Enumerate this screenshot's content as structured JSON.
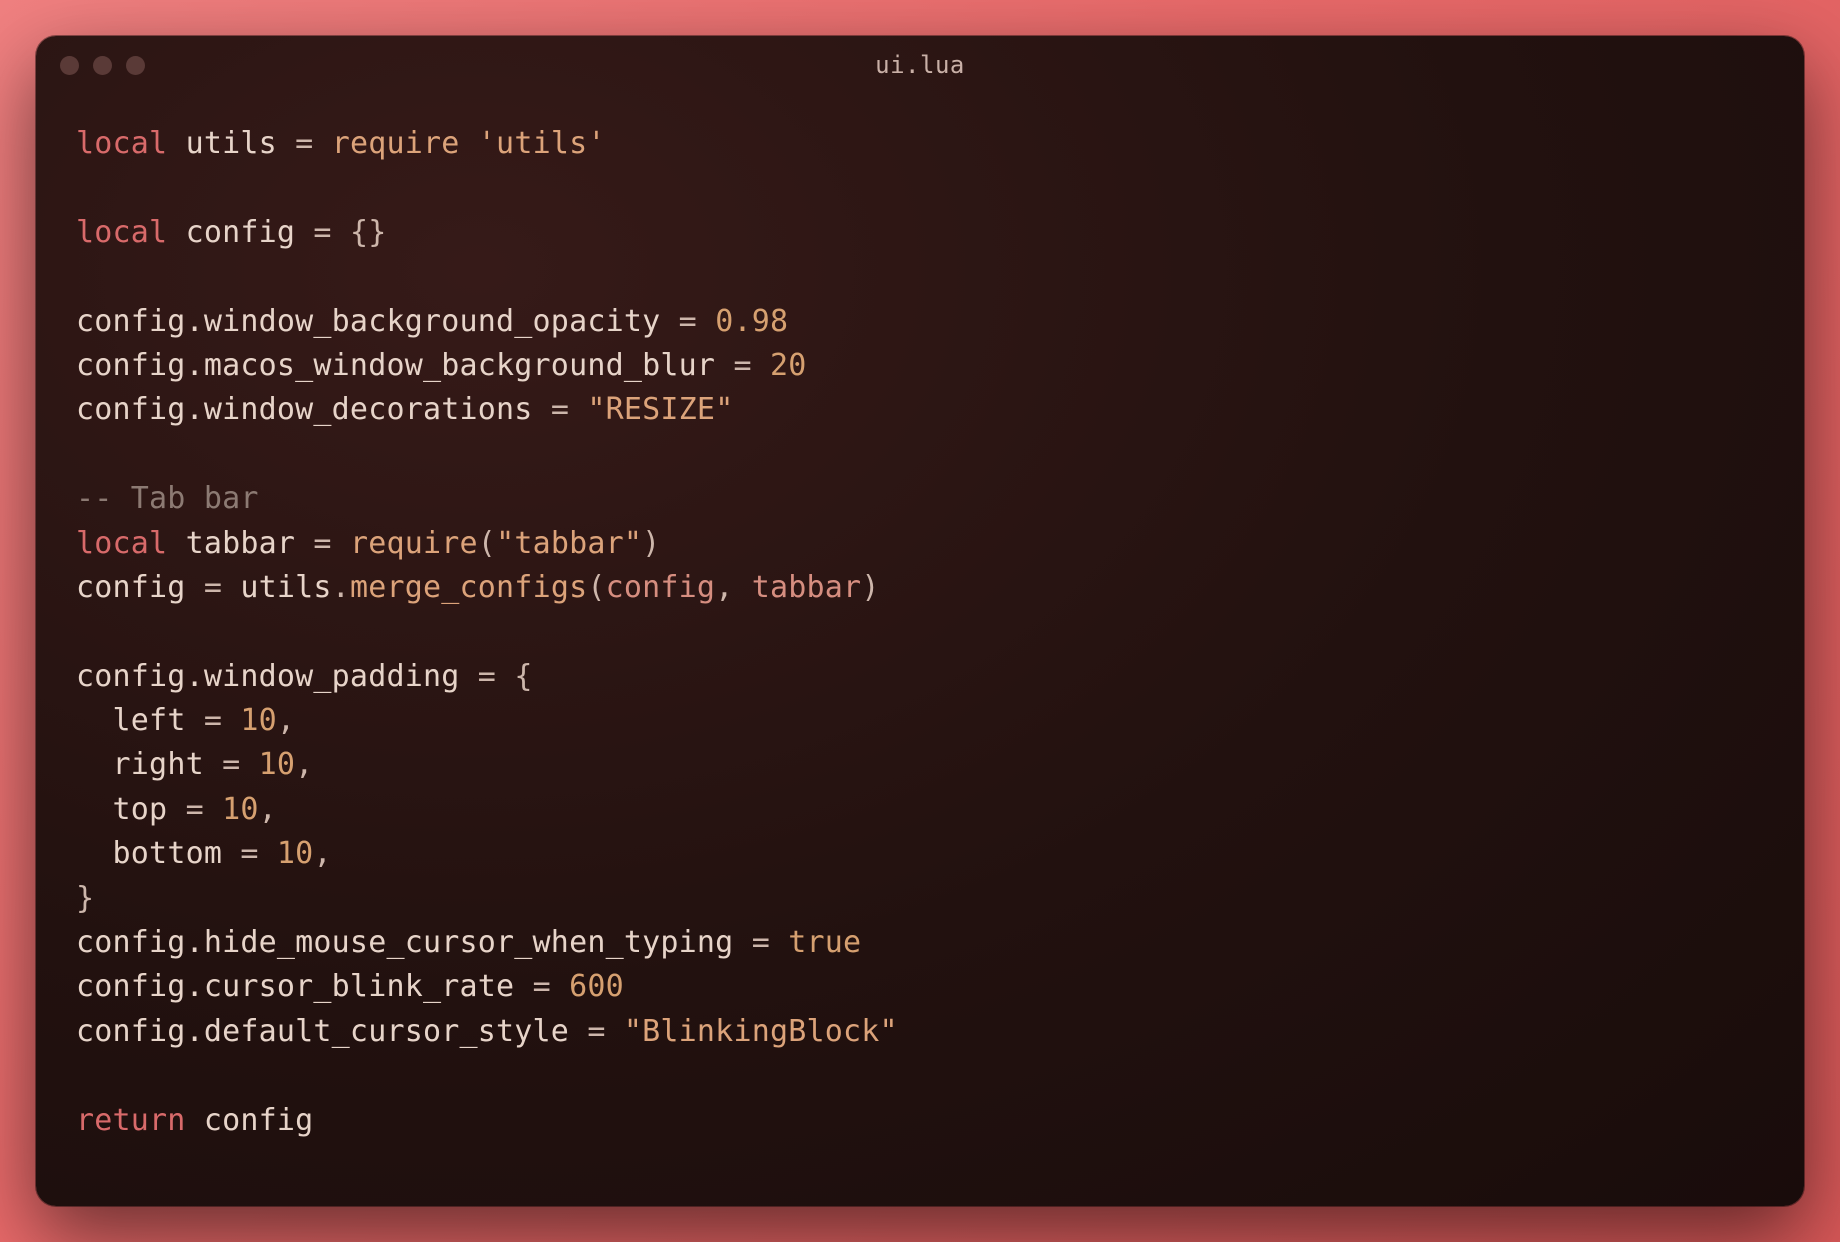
{
  "window": {
    "title": "ui.lua"
  },
  "code": {
    "l1": {
      "kw": "local",
      "id": "utils",
      "op": "=",
      "fn": "require",
      "str": "'utils'"
    },
    "l3": {
      "kw": "local",
      "id": "config",
      "op": "=",
      "p": "{}"
    },
    "l5": {
      "id": "config",
      "prop": ".window_background_opacity",
      "op": "=",
      "num": "0.98"
    },
    "l6": {
      "id": "config",
      "prop": ".macos_window_background_blur",
      "op": "=",
      "num": "20"
    },
    "l7": {
      "id": "config",
      "prop": ".window_decorations",
      "op": "=",
      "str": "\"RESIZE\""
    },
    "l9": {
      "cmt": "-- Tab bar"
    },
    "l10": {
      "kw": "local",
      "id": "tabbar",
      "op": "=",
      "fn": "require",
      "po": "(",
      "str": "\"tabbar\"",
      "pc": ")"
    },
    "l11": {
      "id": "config",
      "op": "=",
      "obj": "utils",
      "dot": ".",
      "fn": "merge_configs",
      "po": "(",
      "a1": "config",
      "comma": ",",
      "a2": "tabbar",
      "pc": ")"
    },
    "l13": {
      "id": "config",
      "prop": ".window_padding",
      "op": "=",
      "p": "{"
    },
    "l14": {
      "pad": "  ",
      "k": "left",
      "op": "=",
      "num": "10",
      "c": ","
    },
    "l15": {
      "pad": "  ",
      "k": "right",
      "op": "=",
      "num": "10",
      "c": ","
    },
    "l16": {
      "pad": "  ",
      "k": "top",
      "op": "=",
      "num": "10",
      "c": ","
    },
    "l17": {
      "pad": "  ",
      "k": "bottom",
      "op": "=",
      "num": "10",
      "c": ","
    },
    "l18": {
      "p": "}"
    },
    "l19": {
      "id": "config",
      "prop": ".hide_mouse_cursor_when_typing",
      "op": "=",
      "bool": "true"
    },
    "l20": {
      "id": "config",
      "prop": ".cursor_blink_rate",
      "op": "=",
      "num": "600"
    },
    "l21": {
      "id": "config",
      "prop": ".default_cursor_style",
      "op": "=",
      "str": "\"BlinkingBlock\""
    },
    "l23": {
      "kw": "return",
      "id": "config"
    }
  }
}
